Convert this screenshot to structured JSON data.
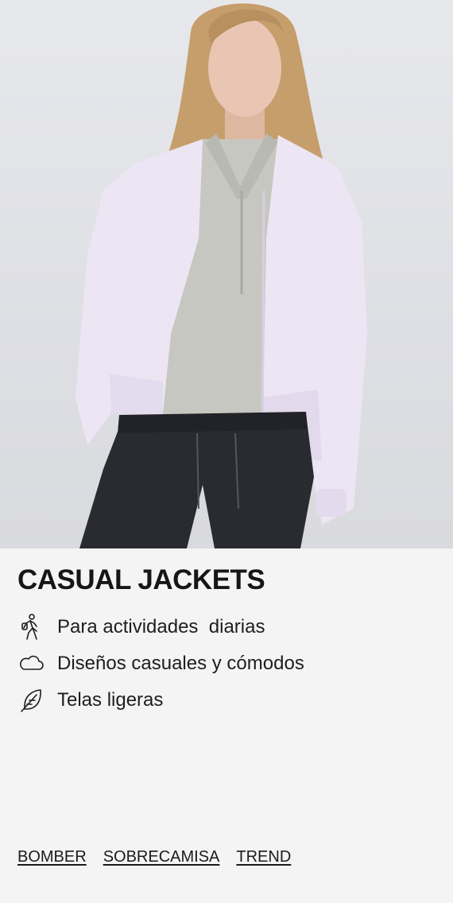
{
  "product_image": {
    "alt": "",
    "colors": {
      "background": "#e3e4e8",
      "jacket": "#ebe4f3",
      "fleece": "#c6c6c0",
      "pants": "#2a2b30",
      "hair": "#c49c6a",
      "skin": "#e6c2ae"
    }
  },
  "collection": {
    "title": "CASUAL JACKETS"
  },
  "features": [
    {
      "icon": "hiker-icon",
      "text": "Para actividades  diarias"
    },
    {
      "icon": "cloud-icon",
      "text": "Diseños casuales y cómodos"
    },
    {
      "icon": "feather-icon",
      "text": "Telas ligeras"
    }
  ],
  "links": [
    {
      "label": "BOMBER"
    },
    {
      "label": "SOBRECAMISA"
    },
    {
      "label": "TREND"
    }
  ]
}
